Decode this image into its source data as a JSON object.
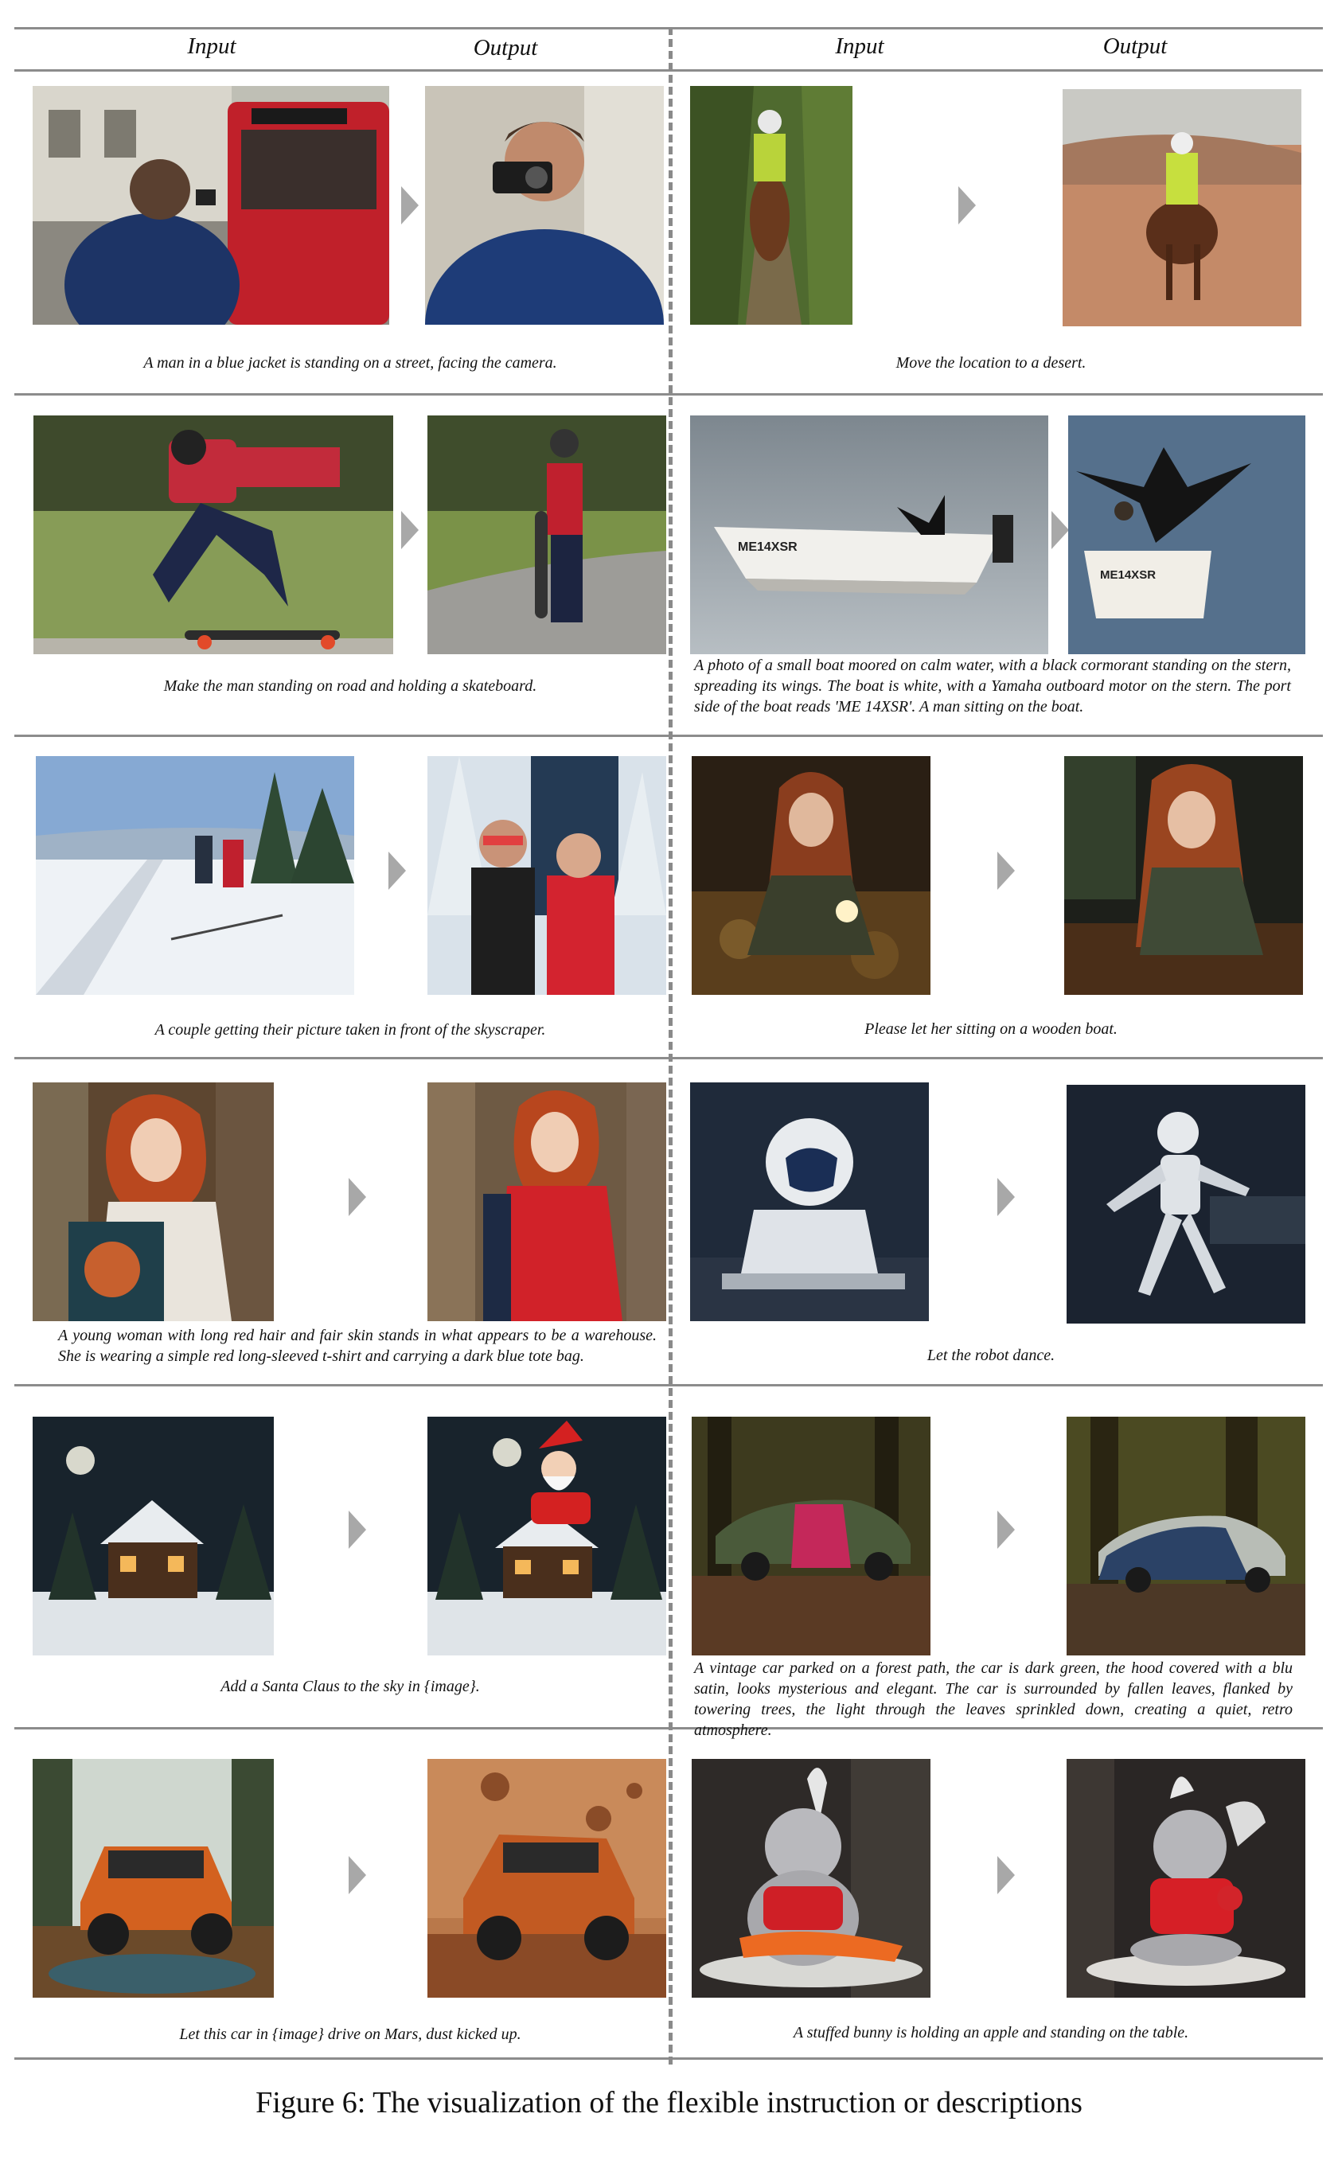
{
  "headers": {
    "left_input": "Input",
    "left_output": "Output",
    "right_input": "Input",
    "right_output": "Output"
  },
  "captions": {
    "r1_left": "A man in a blue jacket is standing on a street, facing the camera.",
    "r1_right": "Move the location to a desert.",
    "r2_left": "Make the man standing on road and holding a skateboard.",
    "r2_right": "A photo of a small boat moored on calm water, with a black cormorant standing on the stern, spreading its wings. The boat is white, with a Yamaha outboard motor on the stern. The port side of the boat reads 'ME 14XSR'. A man sitting on the boat.",
    "r3_left": "A couple getting their picture taken in front of the skyscraper.",
    "r3_right": "Please let her sitting on a wooden boat.",
    "r4_left": "A young woman with long red hair and fair skin stands in what appears to be a warehouse. She is wearing a simple red long-sleeved t-shirt and carrying a dark blue tote bag.",
    "r4_right": "Let the robot dance.",
    "r5_left": "Add a Santa Claus to the sky in {image}.",
    "r5_right": "A vintage car parked on a forest path, the car is dark green, the hood covered with a blu satin, looks mysterious and elegant. The car is surrounded by fallen leaves, flanked by towering trees, the light through the leaves sprinkled down, creating a quiet, retro atmosphere.",
    "r6_left": "Let this car in {image} drive on Mars, dust kicked up.",
    "r6_right": "A stuffed bunny is holding an apple and standing on the table."
  },
  "boat_text": {
    "input_hull": "ME14XSR",
    "output_hull": "ME14XSR"
  },
  "figure_caption": "Figure 6: The visualization of the flexible instruction or descriptions"
}
